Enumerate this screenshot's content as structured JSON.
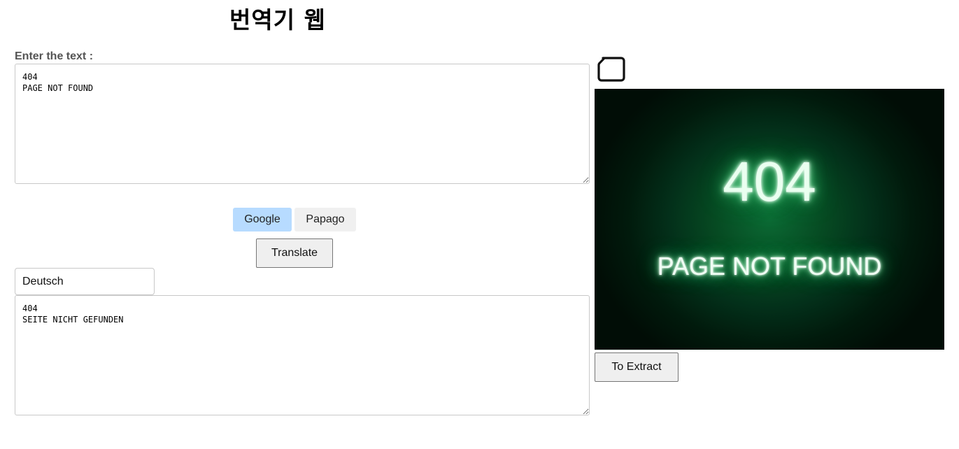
{
  "header": {
    "title": "번역기 웹"
  },
  "source": {
    "label": "Enter the text :",
    "value": "404\nPAGE NOT FOUND"
  },
  "engines": {
    "items": [
      {
        "label": "Google",
        "selected": true
      },
      {
        "label": "Papago",
        "selected": false
      }
    ],
    "selected_color": "#b7dbff",
    "unselected_color": "#f0f0f0"
  },
  "actions": {
    "translate_label": "Translate",
    "extract_label": "To Extract"
  },
  "target_language": {
    "value": "Deutsch"
  },
  "output": {
    "value": "404\nSEITE NICHT GEFUNDEN"
  },
  "upload": {
    "icon": "folder-icon"
  },
  "image_preview": {
    "code": "404",
    "message": "PAGE NOT FOUND",
    "glow_color": "#3bd57a",
    "background_color": "#03301a"
  }
}
